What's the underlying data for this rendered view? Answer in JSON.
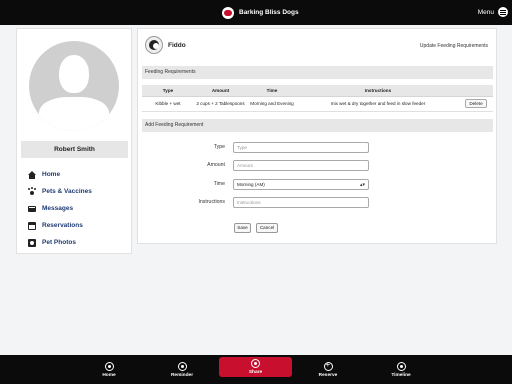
{
  "header": {
    "brand_name": "Barking Bliss Dogs",
    "menu_label": "Menu"
  },
  "sidebar": {
    "user_name": "Robert Smith",
    "items": [
      {
        "label": "Home",
        "icon": "home-icon"
      },
      {
        "label": "Pets & Vaccines",
        "icon": "paw-icon"
      },
      {
        "label": "Messages",
        "icon": "message-icon"
      },
      {
        "label": "Reservations",
        "icon": "calendar-icon"
      },
      {
        "label": "Pet Photos",
        "icon": "photo-icon"
      }
    ]
  },
  "main": {
    "pet_name": "Fiddo",
    "update_link": "Update Feeding Requirements",
    "feeding_section_title": "Feeding Requirements",
    "table": {
      "headers": [
        "Type",
        "Amount",
        "Time",
        "Instructions"
      ],
      "rows": [
        {
          "type": "Kibble + wet",
          "amount": "2 cups + 2 Tablespoons",
          "time": "Morning and Evening",
          "instructions": "mix wet & dry together and feed in slow feeder",
          "action": "Delete"
        }
      ]
    },
    "add_section_title": "Add Feeding Requirement",
    "form": {
      "type_label": "Type",
      "type_placeholder": "Type",
      "amount_label": "Amount",
      "amount_placeholder": "Amount",
      "time_label": "Time",
      "time_value": "Morning (AM)",
      "instructions_label": "Instructions",
      "instructions_placeholder": "Instructions",
      "save_label": "Save",
      "cancel_label": "Cancel"
    }
  },
  "bottom_nav": [
    {
      "label": "Home",
      "icon": "home-icon"
    },
    {
      "label": "Reminder",
      "icon": "reminder-icon"
    },
    {
      "label": "Share",
      "icon": "share-icon",
      "active": true
    },
    {
      "label": "Reserve",
      "icon": "plus-icon"
    },
    {
      "label": "Timeline",
      "icon": "timeline-icon"
    }
  ],
  "colors": {
    "accent": "#c8102e",
    "nav_text": "#1f3b73",
    "bar": "#0b0b0b"
  }
}
